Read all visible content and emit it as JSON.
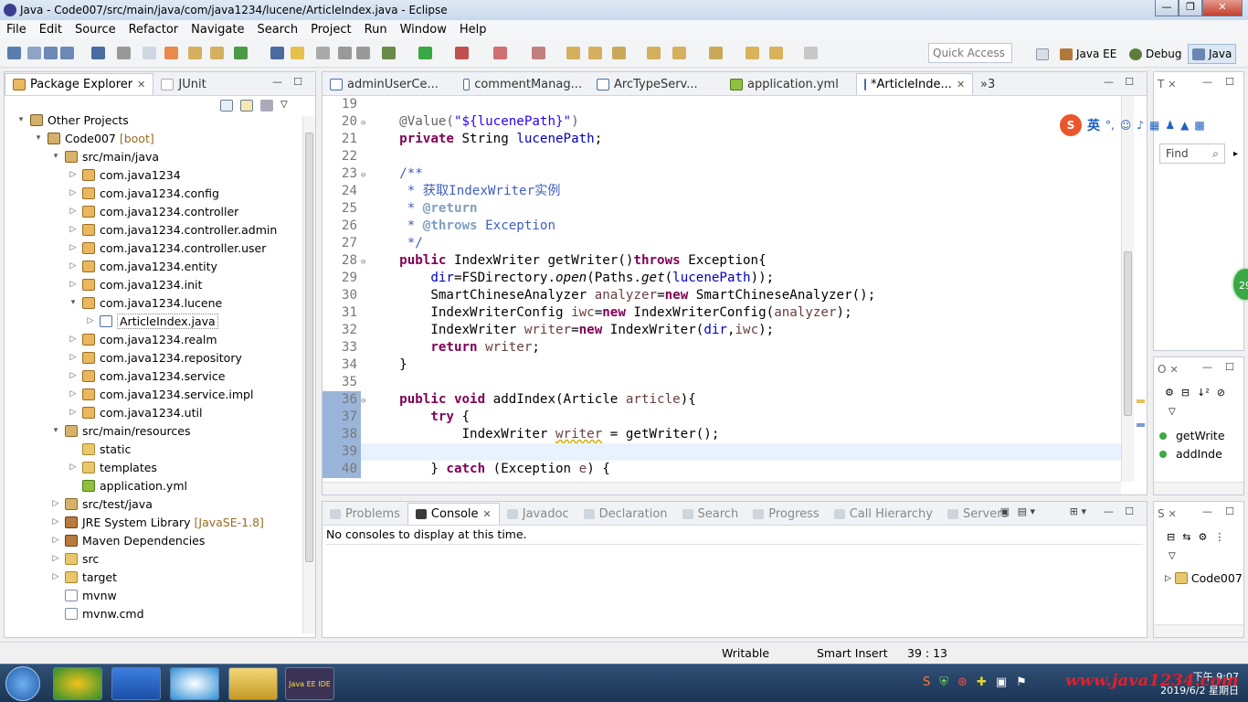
{
  "window": {
    "title": "Java - Code007/src/main/java/com/java1234/lucene/ArticleIndex.java - Eclipse"
  },
  "menu": [
    "File",
    "Edit",
    "Source",
    "Refactor",
    "Navigate",
    "Search",
    "Project",
    "Run",
    "Window",
    "Help"
  ],
  "toolbar": {
    "quick_access_placeholder": "Quick Access"
  },
  "perspectives": [
    {
      "label": "Java EE"
    },
    {
      "label": "Debug"
    },
    {
      "label": "Java"
    }
  ],
  "explorer": {
    "tabs": [
      "Package Explorer",
      "JUnit"
    ],
    "items": [
      {
        "label": "Other Projects",
        "extra": "",
        "indent": 0,
        "arrow": "▾",
        "icon": "proj"
      },
      {
        "label": "Code007",
        "extra": " [boot]",
        "indent": 1,
        "arrow": "▾",
        "icon": "proj"
      },
      {
        "label": "src/main/java",
        "extra": "",
        "indent": 2,
        "arrow": "▾",
        "icon": "src"
      },
      {
        "label": "com.java1234",
        "extra": "",
        "indent": 3,
        "arrow": "▷",
        "icon": "pkg"
      },
      {
        "label": "com.java1234.config",
        "extra": "",
        "indent": 3,
        "arrow": "▷",
        "icon": "pkg"
      },
      {
        "label": "com.java1234.controller",
        "extra": "",
        "indent": 3,
        "arrow": "▷",
        "icon": "pkg"
      },
      {
        "label": "com.java1234.controller.admin",
        "extra": "",
        "indent": 3,
        "arrow": "▷",
        "icon": "pkg"
      },
      {
        "label": "com.java1234.controller.user",
        "extra": "",
        "indent": 3,
        "arrow": "▷",
        "icon": "pkg"
      },
      {
        "label": "com.java1234.entity",
        "extra": "",
        "indent": 3,
        "arrow": "▷",
        "icon": "pkg"
      },
      {
        "label": "com.java1234.init",
        "extra": "",
        "indent": 3,
        "arrow": "▷",
        "icon": "pkg"
      },
      {
        "label": "com.java1234.lucene",
        "extra": "",
        "indent": 3,
        "arrow": "▾",
        "icon": "pkg"
      },
      {
        "label": "ArticleIndex.java",
        "extra": "",
        "indent": 4,
        "arrow": "▷",
        "icon": "java"
      },
      {
        "label": "com.java1234.realm",
        "extra": "",
        "indent": 3,
        "arrow": "▷",
        "icon": "pkg"
      },
      {
        "label": "com.java1234.repository",
        "extra": "",
        "indent": 3,
        "arrow": "▷",
        "icon": "pkg"
      },
      {
        "label": "com.java1234.service",
        "extra": "",
        "indent": 3,
        "arrow": "▷",
        "icon": "pkg"
      },
      {
        "label": "com.java1234.service.impl",
        "extra": "",
        "indent": 3,
        "arrow": "▷",
        "icon": "pkg"
      },
      {
        "label": "com.java1234.util",
        "extra": "",
        "indent": 3,
        "arrow": "▷",
        "icon": "pkg"
      },
      {
        "label": "src/main/resources",
        "extra": "",
        "indent": 2,
        "arrow": "▾",
        "icon": "src"
      },
      {
        "label": "static",
        "extra": "",
        "indent": 3,
        "arrow": "",
        "icon": "folder"
      },
      {
        "label": "templates",
        "extra": "",
        "indent": 3,
        "arrow": "▷",
        "icon": "folder"
      },
      {
        "label": "application.yml",
        "extra": "",
        "indent": 3,
        "arrow": "",
        "icon": "yml"
      },
      {
        "label": "src/test/java",
        "extra": "",
        "indent": 2,
        "arrow": "▷",
        "icon": "src"
      },
      {
        "label": "JRE System Library",
        "extra": " [JavaSE-1.8]",
        "indent": 2,
        "arrow": "▷",
        "icon": "jar"
      },
      {
        "label": "Maven Dependencies",
        "extra": "",
        "indent": 2,
        "arrow": "▷",
        "icon": "jar"
      },
      {
        "label": "src",
        "extra": "",
        "indent": 2,
        "arrow": "▷",
        "icon": "folder"
      },
      {
        "label": "target",
        "extra": "",
        "indent": 2,
        "arrow": "▷",
        "icon": "folder"
      },
      {
        "label": "mvnw",
        "extra": "",
        "indent": 2,
        "arrow": "",
        "icon": "file"
      },
      {
        "label": "mvnw.cmd",
        "extra": "",
        "indent": 2,
        "arrow": "",
        "icon": "file"
      }
    ]
  },
  "editor": {
    "tabs": [
      {
        "label": "adminUserCe...",
        "active": false
      },
      {
        "label": "commentManag...",
        "active": false
      },
      {
        "label": "ArcTypeServ...",
        "active": false
      },
      {
        "label": "application.yml",
        "active": false
      },
      {
        "label": "*ArticleInde...",
        "active": true
      }
    ],
    "overflow": "»3",
    "lines": [
      {
        "n": "19",
        "fold": "",
        "html": ""
      },
      {
        "n": "20",
        "fold": "⊖",
        "html": "    <span class=\"an\">@Value(</span><span class=\"st\">\"${lucenePath}\"</span><span class=\"an\">)</span>"
      },
      {
        "n": "21",
        "fold": "",
        "html": "    <span class=\"kw\">private</span> String <span class=\"fld\">lucenePath</span>;"
      },
      {
        "n": "22",
        "fold": "",
        "html": ""
      },
      {
        "n": "23",
        "fold": "⊖",
        "html": "    <span class=\"cm\">/**</span>"
      },
      {
        "n": "24",
        "fold": "",
        "html": "<span class=\"cm\">     * 获取IndexWriter实例</span>"
      },
      {
        "n": "25",
        "fold": "",
        "html": "<span class=\"cm\">     * </span><span class=\"tag\">@return</span>"
      },
      {
        "n": "26",
        "fold": "",
        "html": "<span class=\"cm\">     * </span><span class=\"tag\">@throws</span><span class=\"cm\"> Exception</span>"
      },
      {
        "n": "27",
        "fold": "",
        "html": "<span class=\"cm\">     */</span>"
      },
      {
        "n": "28",
        "fold": "⊖",
        "html": "    <span class=\"kw\">public</span> IndexWriter getWriter()<span class=\"kw\">throws</span> Exception{"
      },
      {
        "n": "29",
        "fold": "",
        "html": "        <span class=\"fld\">dir</span>=FSDirectory.<span class=\"ital\">open</span>(Paths.<span class=\"ital\">get</span>(<span class=\"fld\">lucenePath</span>));"
      },
      {
        "n": "30",
        "fold": "",
        "html": "        SmartChineseAnalyzer <span class=\"var\">analyzer</span>=<span class=\"kw\">new</span> SmartChineseAnalyzer();"
      },
      {
        "n": "31",
        "fold": "",
        "html": "        IndexWriterConfig <span class=\"var\">iwc</span>=<span class=\"kw\">new</span> IndexWriterConfig(<span class=\"var\">analyzer</span>);"
      },
      {
        "n": "32",
        "fold": "",
        "html": "        IndexWriter <span class=\"var\">writer</span>=<span class=\"kw\">new</span> IndexWriter(<span class=\"fld\">dir</span>,<span class=\"var\">iwc</span>);"
      },
      {
        "n": "33",
        "fold": "",
        "html": "        <span class=\"kw\">return</span> <span class=\"var\">writer</span>;"
      },
      {
        "n": "34",
        "fold": "",
        "html": "    }"
      },
      {
        "n": "35",
        "fold": "",
        "html": ""
      },
      {
        "n": "36",
        "fold": "⊖",
        "html": "    <span class=\"kw\">public</span> <span class=\"kw\">void</span> addIndex(Article <span class=\"var\">article</span>){"
      },
      {
        "n": "37",
        "fold": "",
        "html": "        <span class=\"kw\">try</span> {"
      },
      {
        "n": "38",
        "fold": "",
        "html": "            IndexWriter <span class=\"var sq\">writer</span> = getWriter();"
      },
      {
        "n": "39",
        "fold": "",
        "html": ""
      },
      {
        "n": "40",
        "fold": "",
        "html": "        } <span class=\"kw\">catch</span> (Exception <span class=\"var\">e</span>) {"
      }
    ]
  },
  "bottom": {
    "tabs": [
      "Problems",
      "Console",
      "Javadoc",
      "Declaration",
      "Search",
      "Progress",
      "Call Hierarchy",
      "Servers"
    ],
    "active": "Console",
    "message": "No consoles to display at this time."
  },
  "right_top": {
    "tab": "T",
    "find_placeholder": "Find"
  },
  "right_mid": {
    "tab": "O",
    "items": [
      "getWrite",
      "addInde"
    ]
  },
  "right_bot": {
    "tab": "S",
    "items": [
      "Code007"
    ]
  },
  "status": {
    "writable": "Writable",
    "insert": "Smart Insert",
    "position": "39 : 13"
  },
  "ime": {
    "label": "英"
  },
  "badge": {
    "value": "29"
  },
  "taskbar": {
    "time": "下午 9:07",
    "date": "2019/6/2 星期日",
    "app_label": "Java EE IDE"
  },
  "watermark": "www.java1234.com",
  "colors": {
    "keyword": "#7f0055",
    "field": "#0000c0",
    "string": "#2a00ff",
    "comment": "#3f5fbf"
  }
}
